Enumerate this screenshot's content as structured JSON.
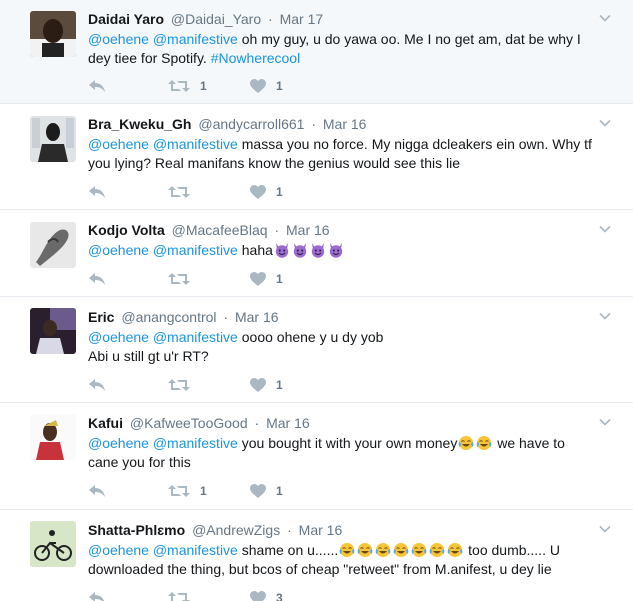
{
  "tweets": [
    {
      "name": "Daidai Yaro",
      "handle": "@Daidai_Yaro",
      "time": "Mar 17",
      "mentions": [
        "@oehene",
        "@manifestive"
      ],
      "text": " oh my guy, u do yawa oo. Me I no get am, dat be why I dey tiee for Spotify. ",
      "hashtag": "#Nowherecool",
      "retweets": "1",
      "likes": "1",
      "avatar": "avatar-daidai"
    },
    {
      "name": "Bra_Kweku_Gh",
      "handle": "@andycarroll661",
      "time": "Mar 16",
      "mentions": [
        "@oehene",
        "@manifestive"
      ],
      "text": " massa you no force. My nigga dcleakers ein own. Why tf you lying? Real manifans know the genius would see this lie",
      "retweets": "",
      "likes": "1",
      "avatar": "avatar-bra-kweku"
    },
    {
      "name": "Kodjo Volta",
      "handle": "@MacafeeBlaq",
      "time": "Mar 16",
      "mentions": [
        "@oehene",
        "@manifestive"
      ],
      "text": " haha",
      "emojis": [
        "smiling-imp",
        "smiling-imp",
        "smiling-imp",
        "smiling-imp"
      ],
      "retweets": "",
      "likes": "1",
      "avatar": "avatar-kodjo"
    },
    {
      "name": "Eric",
      "handle": "@anangcontrol",
      "time": "Mar 16",
      "mentions": [
        "@oehene",
        "@manifestive"
      ],
      "text": " oooo ohene y u dy yob\nAbi u still gt u'r RT?",
      "retweets": "",
      "likes": "1",
      "avatar": "avatar-eric"
    },
    {
      "name": "Kafui",
      "handle": "@KafweeTooGood",
      "time": "Mar 16",
      "mentions": [
        "@oehene",
        "@manifestive"
      ],
      "text": " you bought it with your own money",
      "emojis": [
        "joy",
        "joy"
      ],
      "text_after": " we have to cane you for this",
      "retweets": "1",
      "likes": "1",
      "avatar": "avatar-kafui"
    },
    {
      "name": "Shatta-Phlɛmo",
      "handle": "@AndrewZigs",
      "time": "Mar 16",
      "mentions": [
        "@oehene",
        "@manifestive"
      ],
      "text": " shame on u......",
      "emojis": [
        "joy",
        "joy",
        "joy",
        "joy",
        "joy",
        "joy",
        "joy"
      ],
      "text_after": " too dumb..... U downloaded the thing, but bcos of cheap \"retweet\" from M.anifest, u dey lie",
      "retweets": "",
      "likes": "3",
      "avatar": "avatar-shatta"
    }
  ],
  "colors": {
    "link": "#1b95e0",
    "muted": "#657786",
    "icon": "#aab8c2",
    "divider": "#e6ecf0",
    "highlight_bg": "#f5f8fa"
  }
}
